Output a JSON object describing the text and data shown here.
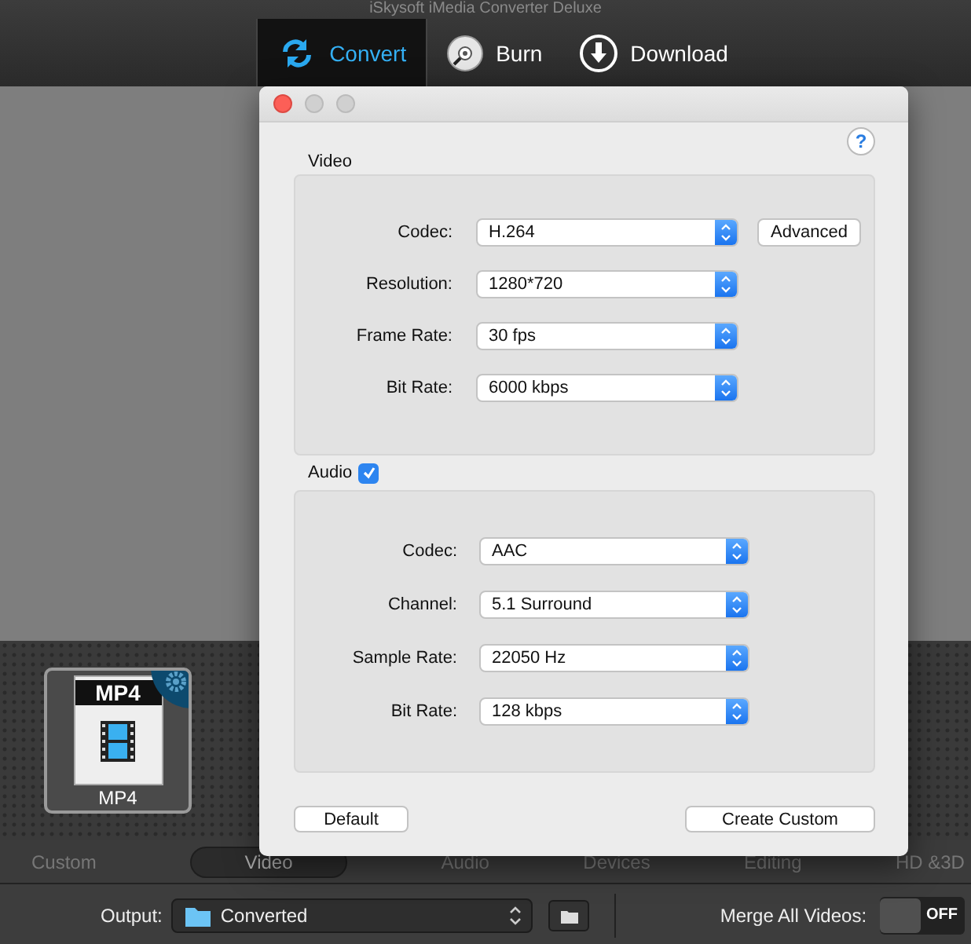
{
  "app": {
    "title": "iSkysoft iMedia Converter Deluxe",
    "tabs": [
      {
        "label": "Convert",
        "kind": "convert",
        "selected": true
      },
      {
        "label": "Burn",
        "kind": "burn",
        "selected": false
      },
      {
        "label": "Download",
        "kind": "download",
        "selected": false
      }
    ]
  },
  "dialog": {
    "help": "?",
    "video": {
      "title": "Video",
      "advanced_button": "Advanced",
      "fields": [
        {
          "label": "Codec:",
          "value": "H.264"
        },
        {
          "label": "Resolution:",
          "value": "1280*720"
        },
        {
          "label": "Frame Rate:",
          "value": "30 fps"
        },
        {
          "label": "Bit Rate:",
          "value": "6000 kbps"
        }
      ]
    },
    "audio": {
      "title": "Audio",
      "checked": true,
      "fields": [
        {
          "label": "Codec:",
          "value": "AAC"
        },
        {
          "label": "Channel:",
          "value": "5.1 Surround"
        },
        {
          "label": "Sample Rate:",
          "value": "22050 Hz"
        },
        {
          "label": "Bit Rate:",
          "value": "128 kbps"
        }
      ]
    },
    "buttons": [
      "Default",
      "Create Custom"
    ]
  },
  "format_card": {
    "badge": "MP4",
    "label": "MP4"
  },
  "categories": [
    {
      "label": "Custom",
      "selected": false
    },
    {
      "label": "Video",
      "selected": true
    },
    {
      "label": "Audio",
      "selected": false
    },
    {
      "label": "Devices",
      "selected": false
    },
    {
      "label": "Editing",
      "selected": false
    },
    {
      "label": "HD &3D",
      "selected": false
    }
  ],
  "output": {
    "label": "Output:",
    "value": "Converted"
  },
  "merge": {
    "label": "Merge All Videos:",
    "on": false,
    "state_text": "OFF"
  }
}
